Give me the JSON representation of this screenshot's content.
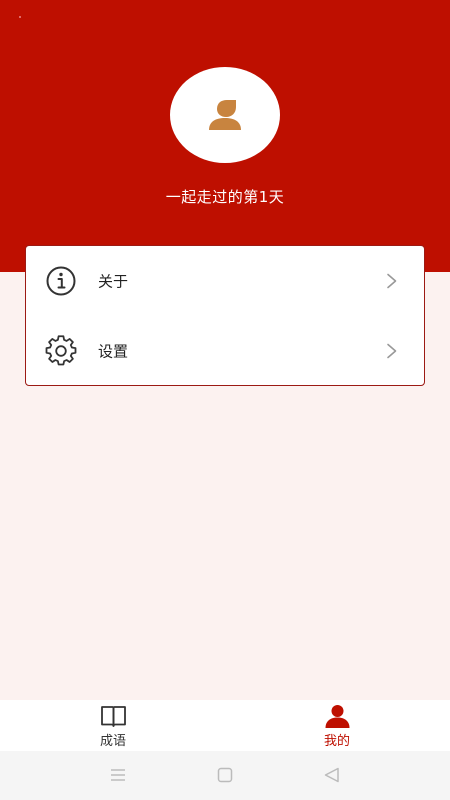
{
  "colors": {
    "primary": "#be0f00",
    "background": "#fcf2f0",
    "avatar": "#c8843f"
  },
  "profile": {
    "days_text": "一起走过的第1天",
    "avatar_icon": "user-icon"
  },
  "menu": [
    {
      "label": "关于",
      "icon": "info-icon"
    },
    {
      "label": "设置",
      "icon": "gear-icon"
    }
  ],
  "tabs": [
    {
      "label": "成语",
      "icon": "book-icon",
      "active": false
    },
    {
      "label": "我的",
      "icon": "user-icon",
      "active": true
    }
  ],
  "system_nav": [
    "menu-icon",
    "home-icon",
    "back-icon"
  ]
}
